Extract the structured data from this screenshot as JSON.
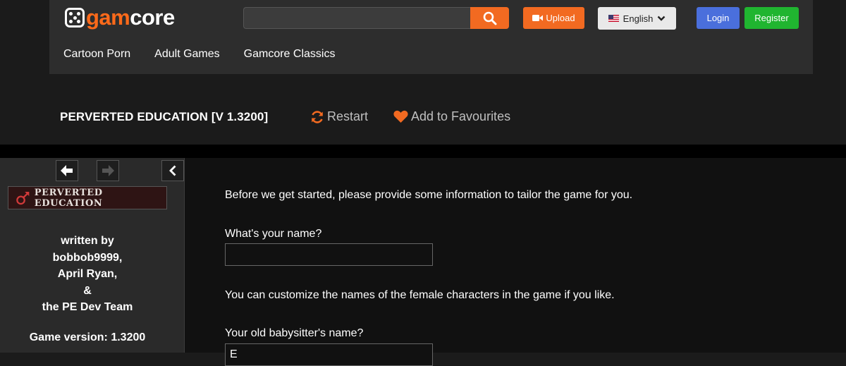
{
  "header": {
    "logo": {
      "part1": "gam",
      "part2": "core"
    },
    "search": {
      "value": "",
      "placeholder": ""
    },
    "upload_label": "Upload",
    "language_label": "English",
    "login_label": "Login",
    "register_label": "Register",
    "nav": [
      "Cartoon Porn",
      "Adult Games",
      "Gamcore Classics"
    ]
  },
  "game": {
    "title": "PERVERTED EDUCATION [V 1.3200]",
    "restart_label": "Restart",
    "favourites_label": "Add to Favourites"
  },
  "sidebar": {
    "banner_text": "PERVERTED EDUCATION",
    "credits": [
      "written by",
      "bobbob9999,",
      "April Ryan,",
      "&",
      "the PE Dev Team"
    ],
    "version": "Game version: 1.3200"
  },
  "main": {
    "intro": "Before we get started, please provide some information to tailor the game for you.",
    "name_question": "What's your name?",
    "name_value": "",
    "customize_text": "You can customize the names of the female characters in the game if you like.",
    "babysitter_question": "Your old babysitter's name?",
    "babysitter_value": "E"
  },
  "colors": {
    "accent": "#f26a21",
    "login": "#4a6fdc",
    "register": "#20b530",
    "header_bg": "#2d2d2d"
  }
}
